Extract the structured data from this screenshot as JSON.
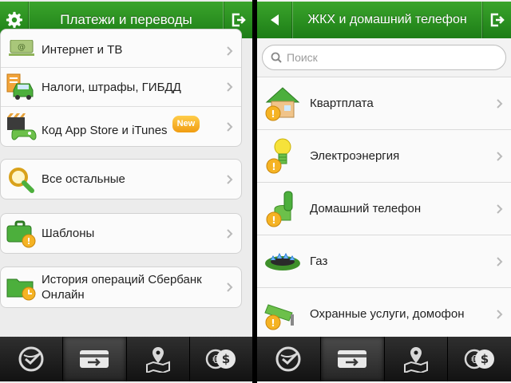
{
  "left": {
    "header": {
      "title": "Платежи и переводы",
      "left_icon": "gear-icon",
      "right_icon": "exit-icon"
    },
    "menu": [
      {
        "label": "Интернет и ТВ",
        "icon": "internet-tv-icon"
      },
      {
        "label": "Налоги, штрафы, ГИБДД",
        "icon": "car-document-icon"
      },
      {
        "label": "Код App Store и iTunes",
        "badge": "New",
        "icon": "film-gamepad-icon"
      },
      {
        "label": "Все остальные",
        "icon": "magnifier-icon"
      },
      {
        "label": "Шаблоны",
        "icon": "briefcase-icon"
      },
      {
        "label": "История операций Сбербанк Онлайн",
        "line1": "История операций Сбербанк",
        "line2": "Онлайн",
        "icon": "folder-clock-icon"
      }
    ]
  },
  "right": {
    "header": {
      "title": "ЖКХ и домашний телефон",
      "left_icon": "back-arrow-icon",
      "right_icon": "exit-icon"
    },
    "search": {
      "placeholder": "Поиск"
    },
    "items": [
      {
        "label": "Квартплата",
        "icon": "house-icon"
      },
      {
        "label": "Электроэнергия",
        "icon": "bulb-icon"
      },
      {
        "label": "Домашний телефон",
        "icon": "phone-icon"
      },
      {
        "label": "Газ",
        "icon": "gas-burner-icon"
      },
      {
        "label": "Охранные услуги, домофон",
        "icon": "camera-icon"
      }
    ]
  },
  "tabbar": [
    {
      "icon": "sberbank-logo-icon",
      "active": false
    },
    {
      "icon": "payments-card-icon",
      "active": true
    },
    {
      "icon": "map-pin-icon",
      "active": false
    },
    {
      "icon": "currency-icon",
      "active": false
    }
  ],
  "colors": {
    "header_green": "#2a9322",
    "tabbar": "#1e1e1e",
    "badge": "#f5a623",
    "currency_dollar": "$",
    "currency_euro": "€"
  }
}
